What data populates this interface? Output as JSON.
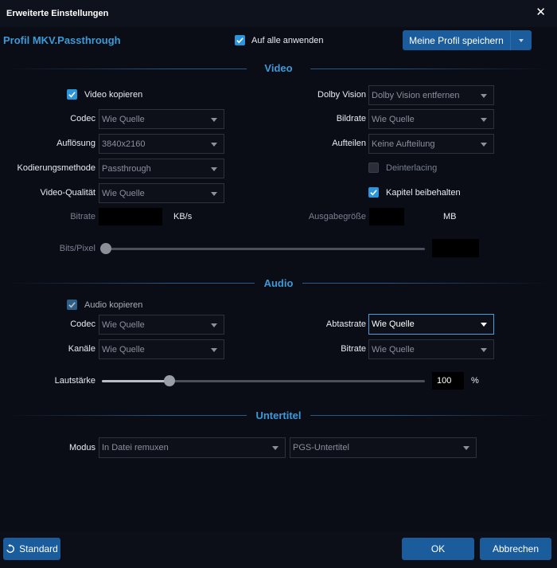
{
  "window": {
    "title": "Erweiterte Einstellungen",
    "close_glyph": "✕"
  },
  "profile": {
    "name": "Profil MKV.Passthrough",
    "apply_all_label": "Auf alle anwenden",
    "save_label": "Meine Profil speichern"
  },
  "video": {
    "section_title": "Video",
    "copy_label": "Video kopieren",
    "codec_label": "Codec",
    "codec_value": "Wie Quelle",
    "resolution_label": "Auflösung",
    "resolution_value": "3840x2160",
    "encoding_label": "Kodierungsmethode",
    "encoding_value": "Passthrough",
    "quality_label": "Video-Qualität",
    "quality_value": "Wie Quelle",
    "bitrate_label": "Bitrate",
    "bitrate_unit": "KB/s",
    "bitspixel_label": "Bits/Pixel",
    "bitspixel_level": 0,
    "dolby_label": "Dolby Vision",
    "dolby_value": "Dolby Vision entfernen",
    "framerate_label": "Bildrate",
    "framerate_value": "Wie Quelle",
    "split_label": "Aufteilen",
    "split_value": "Keine Aufteilung",
    "deinterlace_label": "Deinterlacing",
    "chapters_label": "Kapitel beibehalten",
    "outsize_label": "Ausgabegröße",
    "outsize_unit": "MB"
  },
  "audio": {
    "section_title": "Audio",
    "copy_label": "Audio kopieren",
    "codec_label": "Codec",
    "codec_value": "Wie Quelle",
    "channels_label": "Kanäle",
    "channels_value": "Wie Quelle",
    "samplerate_label": "Abtastrate",
    "samplerate_value": "Wie Quelle",
    "bitrate_label": "Bitrate",
    "bitrate_value": "Wie Quelle",
    "volume_label": "Lautstärke",
    "volume_value": "100",
    "volume_unit": "%"
  },
  "subtitle": {
    "section_title": "Untertitel",
    "mode_label": "Modus",
    "mode_value": "In Datei remuxen",
    "type_value": "PGS-Untertitel"
  },
  "footer": {
    "standard_label": "Standard",
    "ok_label": "OK",
    "cancel_label": "Abbrechen"
  },
  "colors": {
    "accent": "#3d9ad8",
    "button": "#1b5d9c",
    "checkbox": "#2a94dc"
  },
  "icons": [
    "close-icon",
    "checkmark-icon",
    "chevron-down-icon",
    "reset-icon"
  ]
}
